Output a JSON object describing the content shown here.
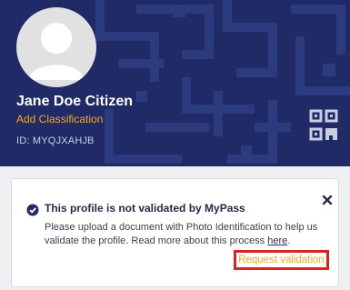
{
  "profile": {
    "name": "Jane Doe Citizen",
    "add_classification": "Add Classification",
    "id_text": "ID: MYQJXAHJB"
  },
  "notice": {
    "title": "This profile is not validated by MyPass",
    "body": "Please upload a document with Photo Identification to help us validate the profile. Read more about this process",
    "link": "here",
    "period": ".",
    "button": "Request validation"
  },
  "icons": {
    "avatar": "avatar-placeholder-icon",
    "qr": "qr-code-icon",
    "check": "check-badge-icon",
    "close": "close-icon"
  },
  "colors": {
    "header_bg": "#1f2a66",
    "accent": "#f6a821",
    "highlight": "#e02020"
  }
}
